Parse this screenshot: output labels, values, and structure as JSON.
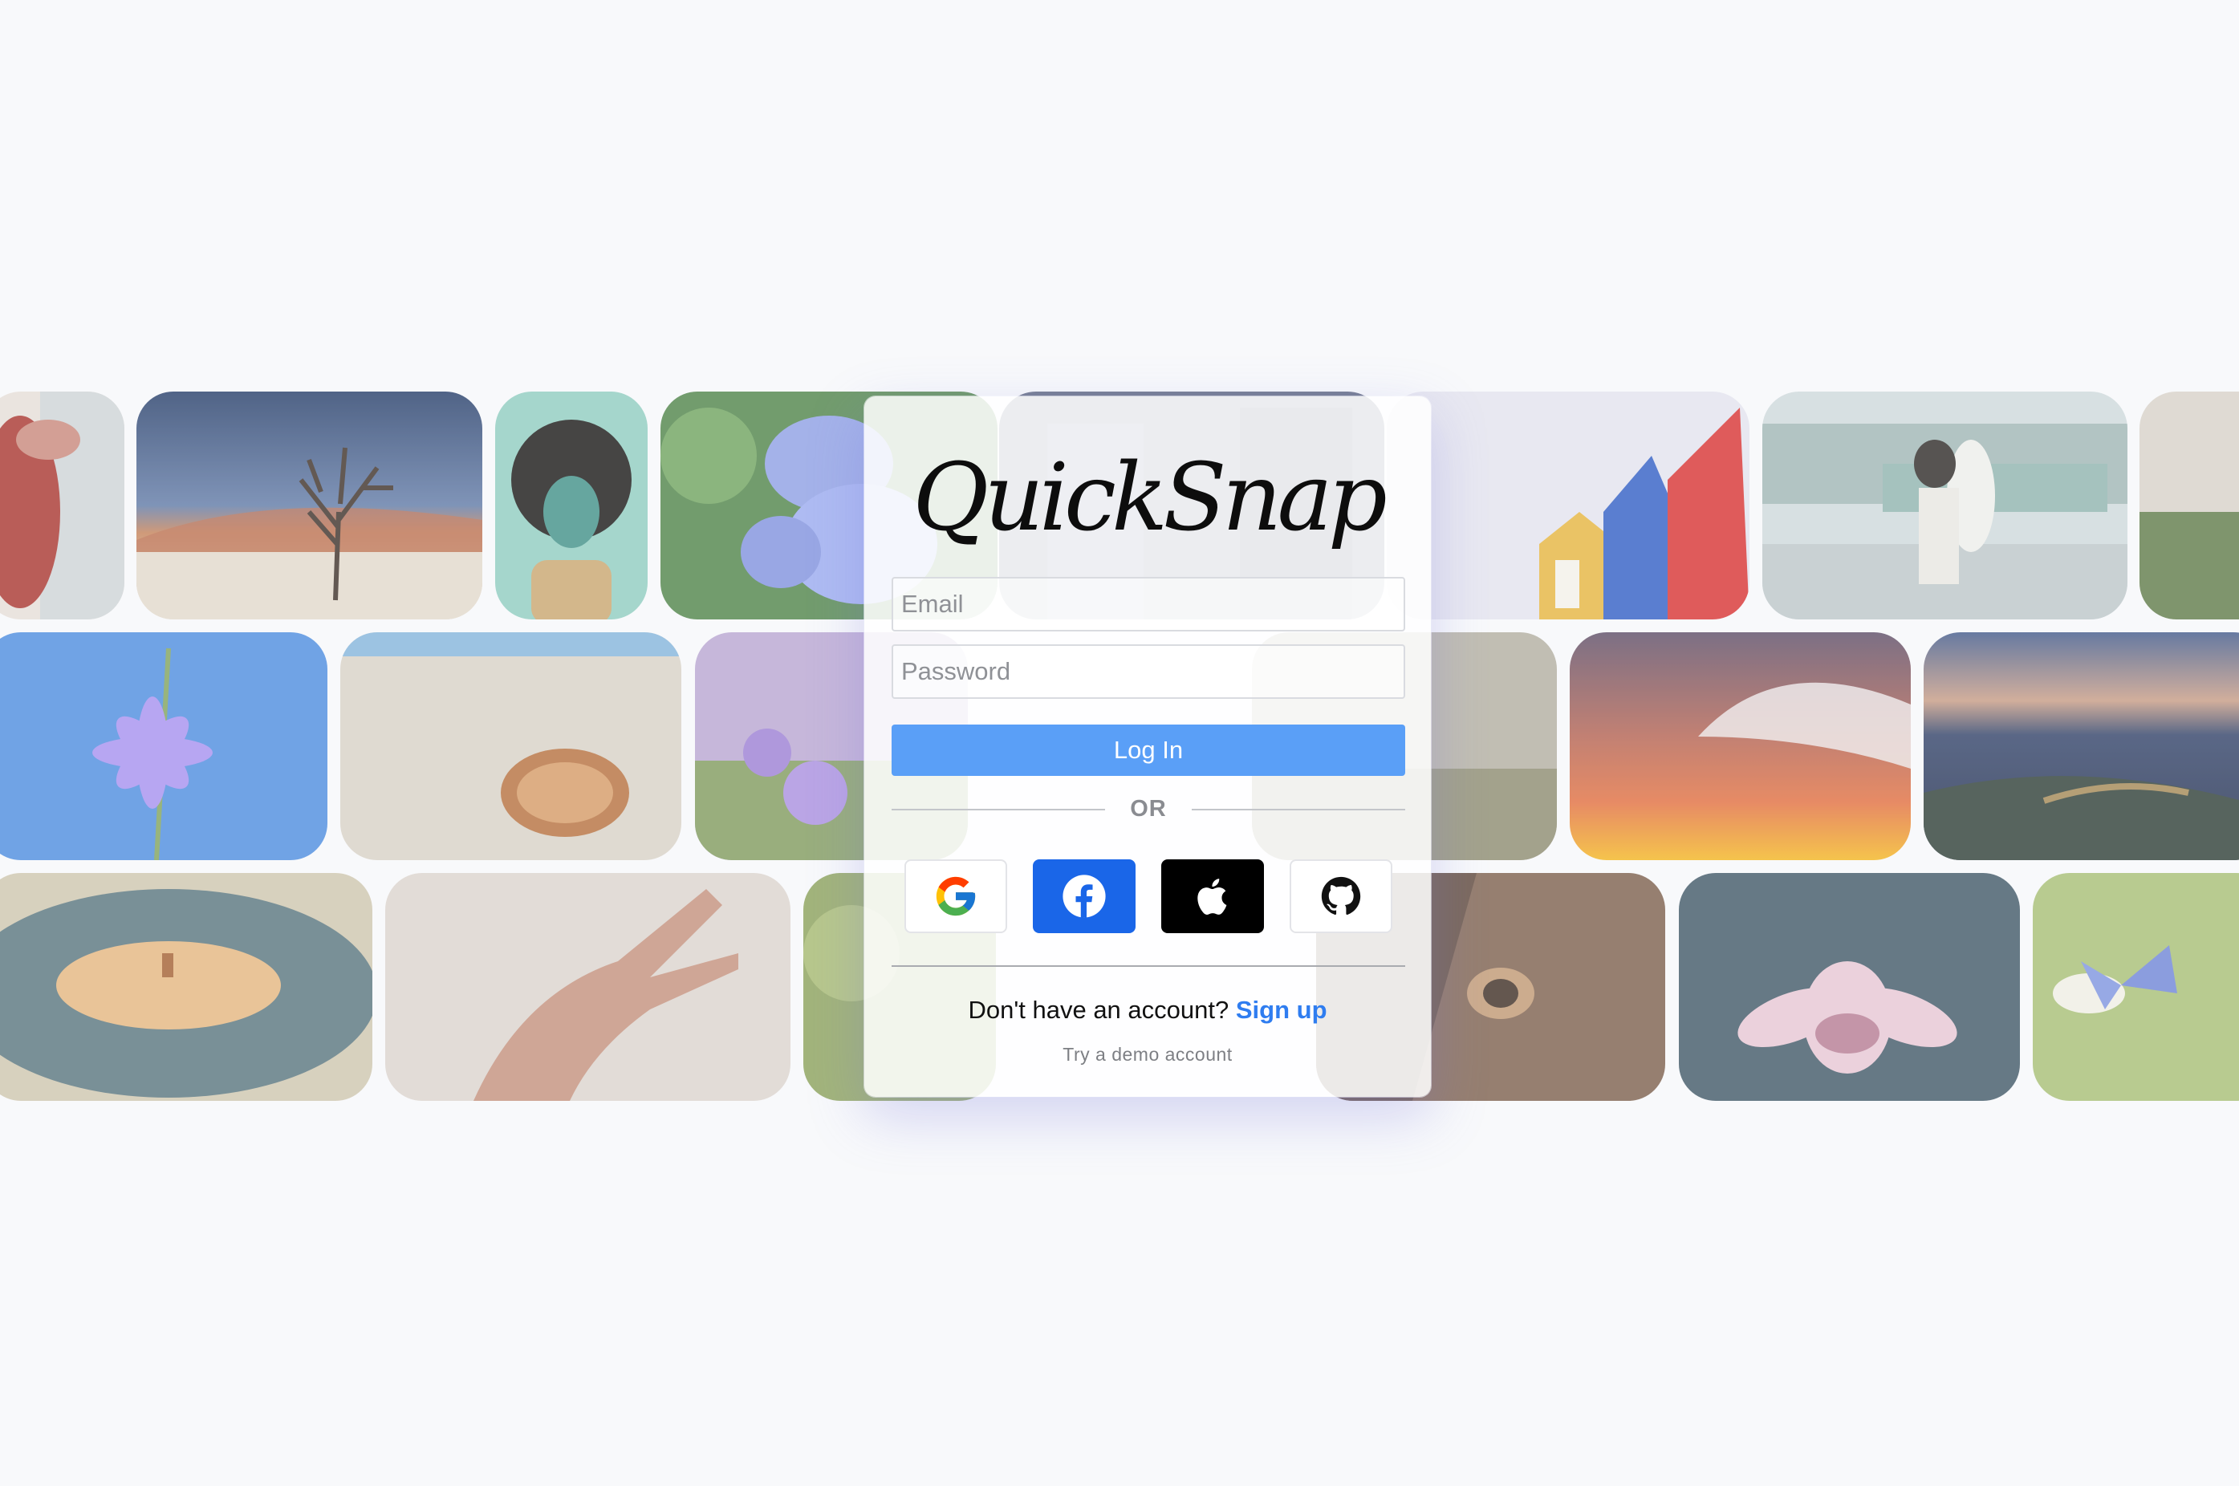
{
  "app": {
    "logo_text": "QuickSnap"
  },
  "login": {
    "email_placeholder": "Email",
    "password_placeholder": "Password",
    "login_label": "Log In",
    "or_label": "OR",
    "signup_prompt": "Don't have an account?",
    "signup_link": "Sign up",
    "demo_link": "Try a demo account"
  },
  "social_buttons": [
    {
      "provider": "google",
      "icon": "google-icon"
    },
    {
      "provider": "facebook",
      "icon": "facebook-icon"
    },
    {
      "provider": "apple",
      "icon": "apple-icon"
    },
    {
      "provider": "github",
      "icon": "github-icon"
    }
  ],
  "background_photos": {
    "row_1": [
      "woman-in-red",
      "dead-tree-desert-night",
      "curly-hair-portrait",
      "blue-flowers",
      "city-street",
      "colorful-houses",
      "couple-on-balcony",
      "grass-field"
    ],
    "row_2": [
      "purple-wildflower",
      "seashell-on-beach",
      "lavender-field",
      "ocean-waves-sunset",
      "mountain-valley-town"
    ],
    "row_3": [
      "vinyl-record",
      "hand-in-sand",
      "green-plant",
      "horse-eye",
      "pink-lotus",
      "blue-butterfly"
    ]
  },
  "colors": {
    "background": "#f8f9fb",
    "primary_button": "#5a9ff7",
    "link": "#2f7df0",
    "facebook": "#1a66e8",
    "apple": "#000000"
  }
}
